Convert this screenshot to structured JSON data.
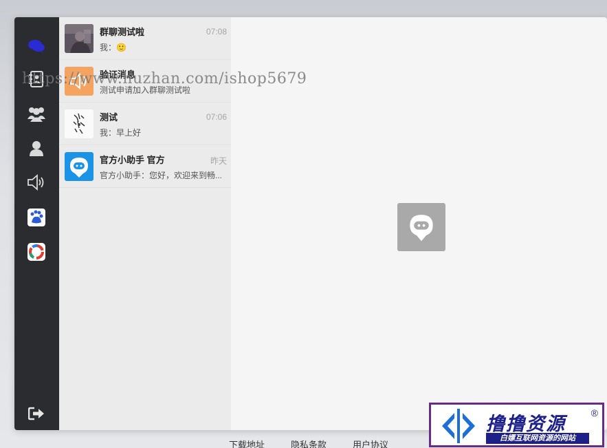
{
  "watermark_url": "https://www.huzhan.com/ishop5679",
  "chats": [
    {
      "name": "群聊测试啦",
      "time": "07:08",
      "message": "我：",
      "message_emoji": "🙂"
    },
    {
      "name": "验证消息",
      "time": "",
      "message": "测试申请加入群聊测试啦"
    },
    {
      "name": "测试",
      "time": "07:06",
      "message": "我：早上好"
    },
    {
      "name": "官方小助手 官方",
      "time": "昨天",
      "message": "官方小助手：您好，欢迎来到畅..."
    }
  ],
  "sidebar": {
    "icons": [
      "chat-bubble-icon",
      "contacts-book-icon",
      "group-icon",
      "user-icon",
      "speaker-icon",
      "baidu-icon",
      "app-icon"
    ],
    "logout_icon": "logout-icon",
    "active_color": "#2a2bd4"
  },
  "footer": {
    "download": "下载地址",
    "privacy": "隐私条款",
    "agreement": "用户协议"
  },
  "brand": {
    "name": "撸撸资源",
    "registered": "®",
    "tagline": "白嫖互联网资源的网站"
  }
}
